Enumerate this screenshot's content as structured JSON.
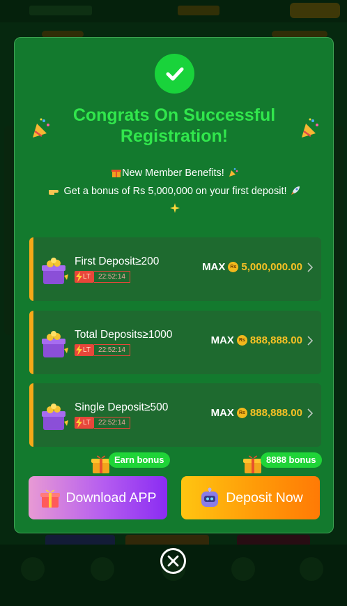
{
  "modal": {
    "title": "Congrats On Successful Registration!",
    "benefits_line1": "New Member Benefits!",
    "benefits_line2": "Get a bonus of Rs 5,000,000 on your first deposit!"
  },
  "bonuses": [
    {
      "condition": "First Deposit≥200",
      "timer_tag": "LT",
      "timer": "22:52:14",
      "max_label": "MAX",
      "currency": "Rs",
      "amount": "5,000,000.00"
    },
    {
      "condition": "Total Deposits≥1000",
      "timer_tag": "LT",
      "timer": "22:52:14",
      "max_label": "MAX",
      "currency": "Rs",
      "amount": "888,888.00"
    },
    {
      "condition": "Single Deposit≥500",
      "timer_tag": "LT",
      "timer": "22:52:14",
      "max_label": "MAX",
      "currency": "Rs",
      "amount": "888,888.00"
    }
  ],
  "actions": {
    "download": {
      "label": "Download APP",
      "tag": "Earn bonus"
    },
    "deposit": {
      "label": "Deposit Now",
      "tag": "8888 bonus"
    }
  },
  "icons": {
    "success": "check-circle-icon",
    "close": "close-circle-icon",
    "decor": "party-popper-icon"
  },
  "colors": {
    "modal_bg": "#137a2e",
    "title": "#31e64c",
    "accent": "#f6a818",
    "amount": "#f7c125",
    "tag_bg": "#1fd438",
    "timer_red": "#e8463a"
  }
}
